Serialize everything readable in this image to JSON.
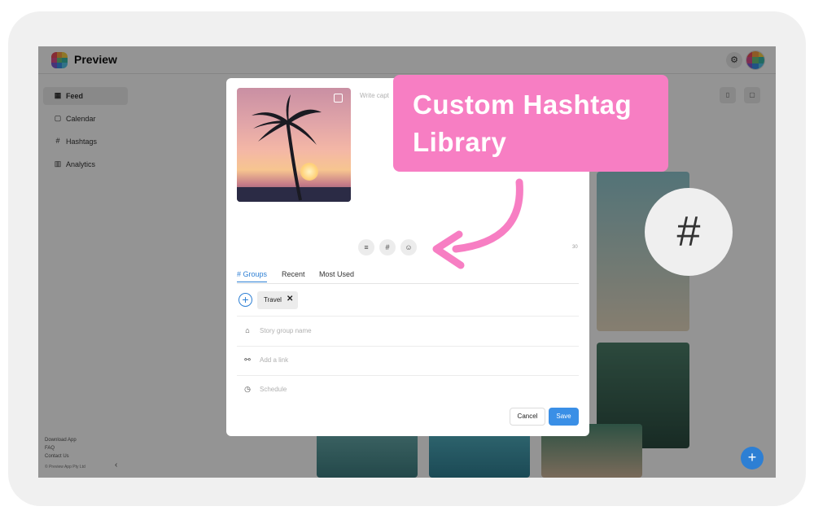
{
  "app": {
    "title": "Preview"
  },
  "sidebar": {
    "items": [
      {
        "label": "Feed",
        "icon": "grid-icon",
        "active": true
      },
      {
        "label": "Calendar",
        "icon": "calendar-icon"
      },
      {
        "label": "Hashtags",
        "icon": "hashtag-icon"
      },
      {
        "label": "Analytics",
        "icon": "bar-chart-icon"
      }
    ],
    "footer_links": [
      "Download App",
      "FAQ",
      "Contact Us"
    ],
    "copyright": "© Preview App Pty Ltd"
  },
  "modal": {
    "caption_placeholder": "Write capt",
    "char_count": "30",
    "tabs": [
      "# Groups",
      "Recent",
      "Most Used"
    ],
    "chip": {
      "label": "Travel"
    },
    "fields": [
      {
        "icon": "tag-icon",
        "placeholder": "Story group name"
      },
      {
        "icon": "link-icon",
        "placeholder": "Add a link"
      },
      {
        "icon": "clock-icon",
        "placeholder": "Schedule"
      }
    ],
    "cancel_label": "Cancel",
    "save_label": "Save"
  },
  "callout": {
    "line1": "Custom Hashtag",
    "line2": "Library"
  },
  "hash_symbol": "#",
  "colors": {
    "accent": "#2d7fd4",
    "callout": "#f77ec3"
  }
}
